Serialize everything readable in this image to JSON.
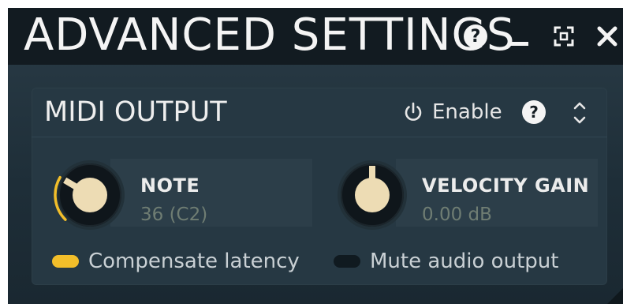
{
  "window": {
    "title": "ADVANCED SETTINGS",
    "help_icon": "question-mark-icon",
    "minimize_icon": "minimize-icon",
    "maximize_icon": "fullscreen-icon",
    "close_icon": "close-icon"
  },
  "panel": {
    "title": "MIDI OUTPUT",
    "enable_icon": "power-icon",
    "enable_label": "Enable",
    "help_icon": "question-mark-icon",
    "collapse_icon": "chevron-updown-icon"
  },
  "controls": [
    {
      "name": "NOTE",
      "value": "36 (C2)",
      "knob_fraction": 0.28
    },
    {
      "name": "VELOCITY GAIN",
      "value": "0.00 dB",
      "knob_fraction": 0.5
    }
  ],
  "toggles": [
    {
      "label": "Compensate latency",
      "state": "on"
    },
    {
      "label": "Mute audio output",
      "state": "off"
    }
  ],
  "colors": {
    "accent": "#f2be2a",
    "knob_cap": "#eddcb4",
    "background": "#1e2e38",
    "titlebar": "#121b21"
  }
}
